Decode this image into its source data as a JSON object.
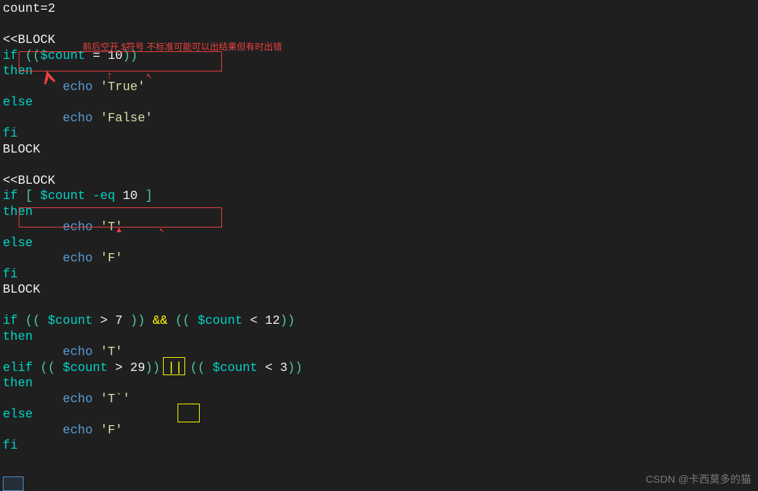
{
  "code": {
    "l1_count": "count",
    "l1_eq": "=",
    "l1_val": "2",
    "l3_block": "<<BLOCK",
    "l4_if": "if ",
    "l4_p1": "((",
    "l4_var": "$count",
    "l4_eq": " = ",
    "l4_num": "10",
    "l4_p2": "))",
    "l5_then": "then",
    "l6_indent": "        ",
    "l6_echo": "echo ",
    "l6_str": "'True'",
    "l7_else": "else",
    "l8_echo": "echo ",
    "l8_str": "'False'",
    "l9_fi": "fi",
    "l10_block": "BLOCK",
    "l12_block": "<<BLOCK",
    "l13_if": "if ",
    "l13_b1": "[ ",
    "l13_var": "$count",
    "l13_eq": " -eq ",
    "l13_num": "10",
    "l13_b2": " ]",
    "l14_then": "then",
    "l15_echo": "echo ",
    "l15_str": "'T'",
    "l16_else": "else",
    "l17_echo": "echo ",
    "l17_str": "'F'",
    "l18_fi": "fi",
    "l19_block": "BLOCK",
    "l21_if": "if ",
    "l21_p1": "(( ",
    "l21_var1": "$count",
    "l21_gt": " > ",
    "l21_num1": "7",
    "l21_p2": " )) ",
    "l21_op": "&&",
    "l21_p3": " (( ",
    "l21_var2": "$count",
    "l21_lt": " < ",
    "l21_num2": "12",
    "l21_p4": "))",
    "l22_then": "then",
    "l23_echo": "echo ",
    "l23_str": "'T'",
    "l24_elif": "elif ",
    "l24_p1": "(( ",
    "l24_var1": "$count",
    "l24_gt": " > ",
    "l24_num1": "29",
    "l24_p2": ")) ",
    "l24_op": "||",
    "l24_p3": " (( ",
    "l24_var2": "$count",
    "l24_lt": " < ",
    "l24_num2": "3",
    "l24_p4": "))",
    "l25_then": "then",
    "l26_echo": "echo ",
    "l26_str": "'T`'",
    "l27_else": "else",
    "l28_echo": "echo ",
    "l28_str": "'F'",
    "l29_fi": "fi"
  },
  "annotations": {
    "comment": "前后空开 $符号 不标准可能可以出结果但有时出错"
  },
  "watermark": "CSDN @卡西莫多的猫"
}
